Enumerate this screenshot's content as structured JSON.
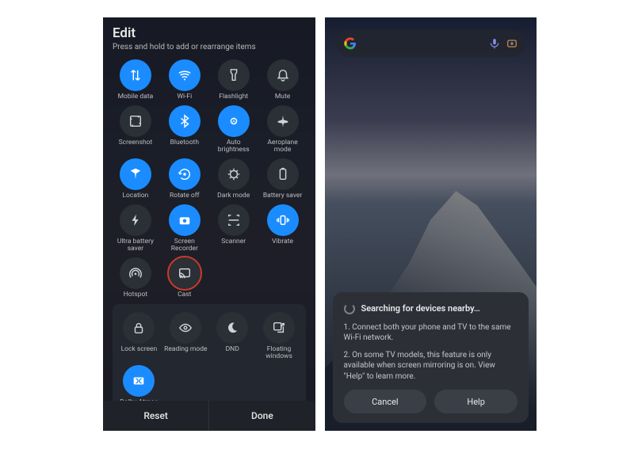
{
  "left": {
    "title": "Edit",
    "subtitle": "Press and hold to add or rearrange items",
    "tiles": [
      {
        "id": "mobile-data",
        "label": "Mobile data",
        "on": true,
        "icon": "arrows-updown"
      },
      {
        "id": "wifi",
        "label": "Wi-Fi",
        "on": true,
        "icon": "wifi"
      },
      {
        "id": "flashlight",
        "label": "Flashlight",
        "on": false,
        "icon": "flashlight"
      },
      {
        "id": "mute",
        "label": "Mute",
        "on": false,
        "icon": "bell"
      },
      {
        "id": "screenshot",
        "label": "Screenshot",
        "on": false,
        "icon": "screenshot"
      },
      {
        "id": "bluetooth",
        "label": "Bluetooth",
        "on": true,
        "icon": "bluetooth"
      },
      {
        "id": "auto-brightness",
        "label": "Auto brightness",
        "on": true,
        "icon": "brightness-a"
      },
      {
        "id": "aeroplane-mode",
        "label": "Aeroplane mode",
        "on": false,
        "icon": "airplane"
      },
      {
        "id": "location",
        "label": "Location",
        "on": true,
        "icon": "location"
      },
      {
        "id": "rotate-off",
        "label": "Rotate off",
        "on": true,
        "icon": "rotate"
      },
      {
        "id": "dark-mode",
        "label": "Dark mode",
        "on": false,
        "icon": "darkmode"
      },
      {
        "id": "battery-saver",
        "label": "Battery saver",
        "on": false,
        "icon": "battery"
      },
      {
        "id": "ultra-battery",
        "label": "Ultra battery saver",
        "on": false,
        "icon": "bolt"
      },
      {
        "id": "screen-recorder",
        "label": "Screen Recorder",
        "on": true,
        "icon": "camera"
      },
      {
        "id": "scanner",
        "label": "Scanner",
        "on": false,
        "icon": "scanner"
      },
      {
        "id": "vibrate",
        "label": "Vibrate",
        "on": true,
        "icon": "vibrate"
      },
      {
        "id": "hotspot",
        "label": "Hotspot",
        "on": false,
        "icon": "hotspot"
      },
      {
        "id": "cast",
        "label": "Cast",
        "on": false,
        "icon": "cast",
        "highlight": true
      }
    ],
    "section2": [
      {
        "id": "lock-screen",
        "label": "Lock screen",
        "icon": "lock"
      },
      {
        "id": "reading-mode",
        "label": "Reading mode",
        "icon": "eye"
      },
      {
        "id": "dnd",
        "label": "DND",
        "icon": "moon"
      },
      {
        "id": "floating-win",
        "label": "Floating windows",
        "icon": "float"
      },
      {
        "id": "dolby-atmos",
        "label": "Dolby Atmos",
        "on": true,
        "icon": "dolby"
      }
    ],
    "footer": {
      "reset": "Reset",
      "done": "Done"
    }
  },
  "right": {
    "modal": {
      "title": "Searching for devices nearby…",
      "line1": "1. Connect both your phone and TV to the same Wi-Fi network.",
      "line2": "2. On some TV models, this feature is only available when screen mirroring is on. View \"Help\" to learn more.",
      "cancel": "Cancel",
      "help": "Help"
    }
  }
}
